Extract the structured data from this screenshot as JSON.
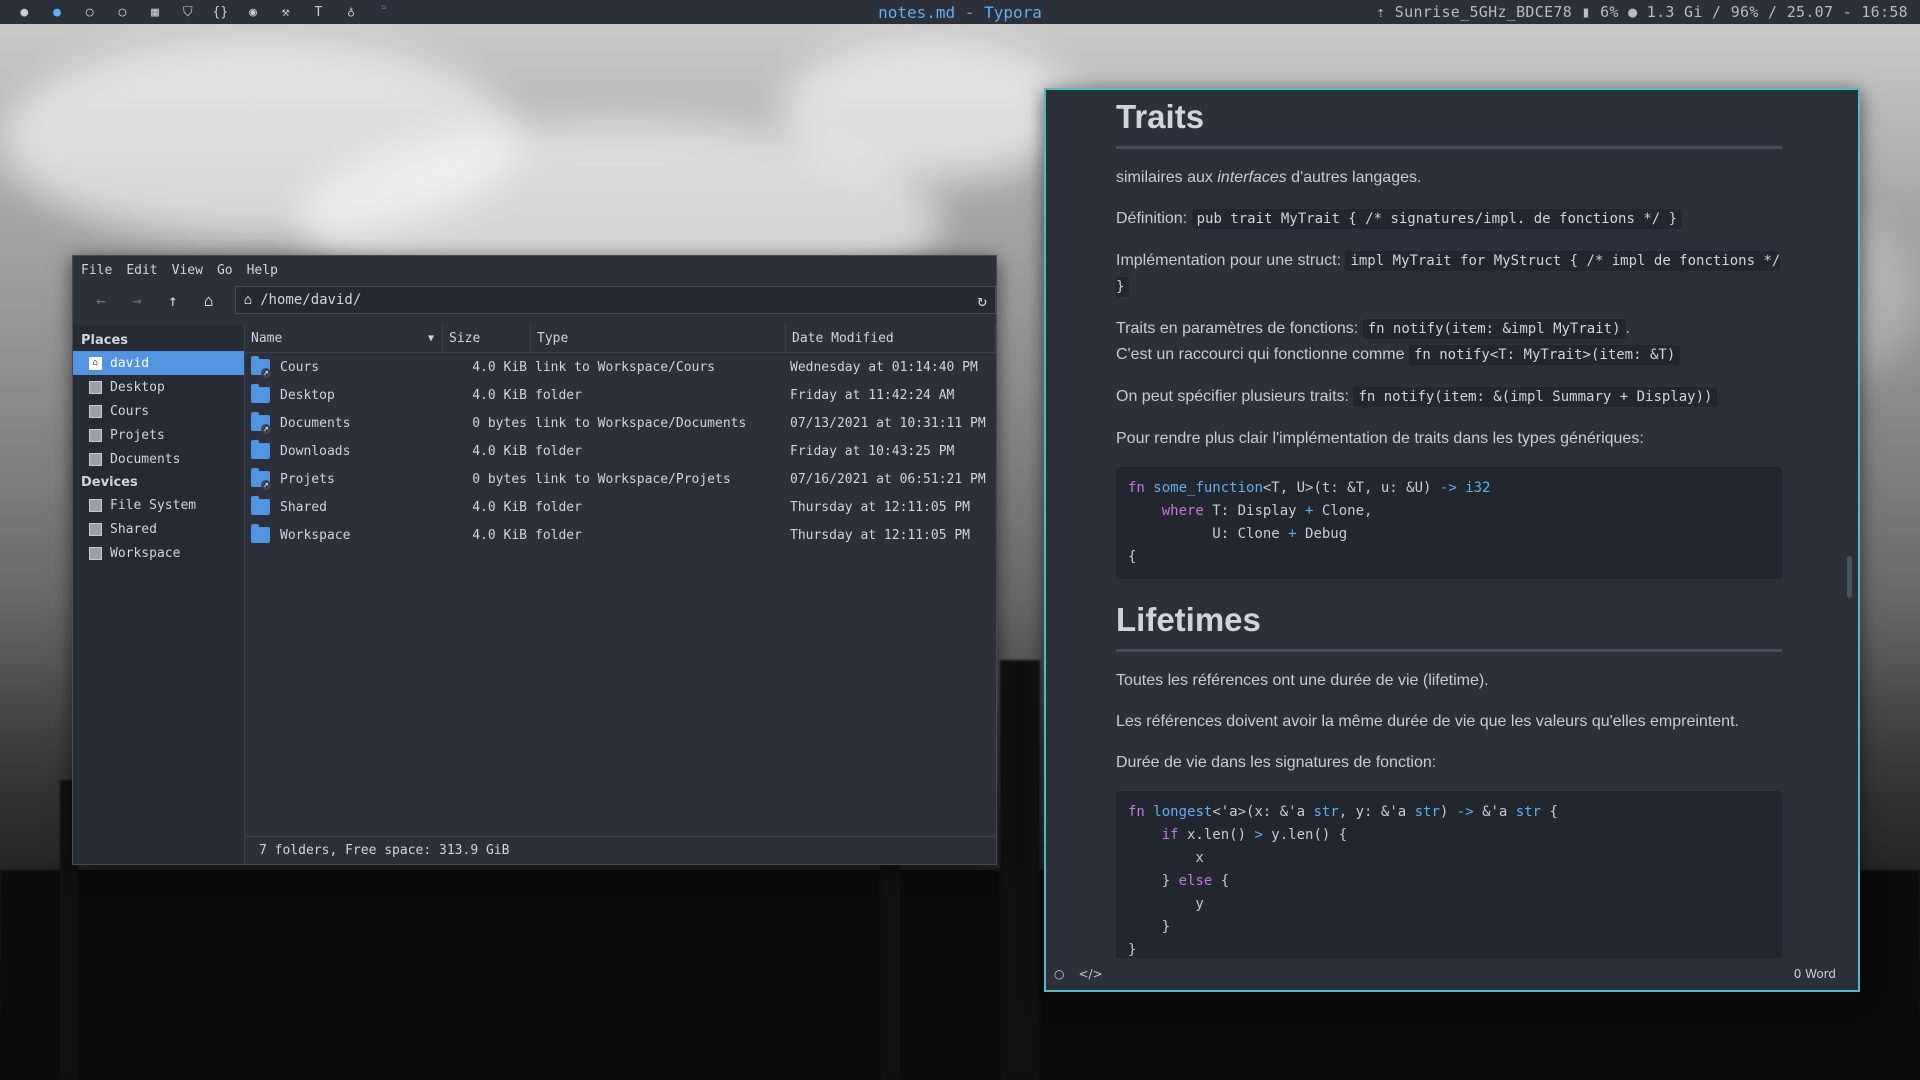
{
  "topbar": {
    "icons": [
      "circle-icon",
      "circle-icon",
      "circle-outline-icon",
      "circle-outline-icon",
      "grid-icon",
      "shield-icon",
      "braces-icon",
      "disc-icon",
      "wrench-icon",
      "text-icon",
      "drop-icon",
      "dot-icon"
    ],
    "title": "notes.md - Typora",
    "status": "⇡ Sunrise_5GHz_BDCE78  ▮ 6%  ● 1.3 Gi / 96% / 25.07 - 16:58"
  },
  "file_manager": {
    "menu": [
      "File",
      "Edit",
      "View",
      "Go",
      "Help"
    ],
    "path": "/home/david/",
    "places_heading": "Places",
    "places": [
      "david",
      "Desktop",
      "Cours",
      "Projets",
      "Documents"
    ],
    "devices_heading": "Devices",
    "devices": [
      "File System",
      "Shared",
      "Workspace"
    ],
    "columns": [
      "Name",
      "Size",
      "Type",
      "Date Modified"
    ],
    "rows": [
      {
        "name": "Cours",
        "size": "4.0 KiB",
        "type": "link to Workspace/Cours",
        "date": "Wednesday at 01:14:40 PM",
        "link": true
      },
      {
        "name": "Desktop",
        "size": "4.0 KiB",
        "type": "folder",
        "date": "Friday at 11:42:24 AM",
        "link": false
      },
      {
        "name": "Documents",
        "size": "0 bytes",
        "type": "link to Workspace/Documents",
        "date": "07/13/2021 at 10:31:11 PM",
        "link": true
      },
      {
        "name": "Downloads",
        "size": "4.0 KiB",
        "type": "folder",
        "date": "Friday at 10:43:25 PM",
        "link": false
      },
      {
        "name": "Projets",
        "size": "0 bytes",
        "type": "link to Workspace/Projets",
        "date": "07/16/2021 at 06:51:21 PM",
        "link": true
      },
      {
        "name": "Shared",
        "size": "4.0 KiB",
        "type": "folder",
        "date": "Thursday at 12:11:05 PM",
        "link": false
      },
      {
        "name": "Workspace",
        "size": "4.0 KiB",
        "type": "folder",
        "date": "Thursday at 12:11:05 PM",
        "link": false
      }
    ],
    "status": "7 folders, Free space: 313.9 GiB"
  },
  "typora": {
    "h1_traits": "Traits",
    "p1_a": "similaires aux ",
    "p1_em": "interfaces",
    "p1_b": " d'autres langages.",
    "p2_label": "Définition: ",
    "p2_code": "pub trait MyTrait { /* signatures/impl. de fonctions */  }",
    "p3_label": "Implémentation pour une struct: ",
    "p3_code": "impl MyTrait for MyStruct { /* impl de fonctions */ }",
    "p4_label": "Traits en paramètres de fonctions: ",
    "p4_code": "fn notify(item: &impl MyTrait)",
    "p4_end": ".",
    "p4b_label": "C'est un raccourci qui fonctionne comme ",
    "p4b_code": "fn notify<T: MyTrait>(item: &T)",
    "p5_label": "On peut spécifier plusieurs traits: ",
    "p5_code": "fn notify(item: &(impl Summary + Display))",
    "p6": "Pour rendre plus clair l'implémentation de traits dans les types génériques:",
    "h1_lifetimes": "Lifetimes",
    "p7": "Toutes les références ont une durée de vie (lifetime).",
    "p8": "Les références doivent avoir la même durée de vie que les valeurs qu'elles empreintent.",
    "p9": "Durée de vie dans les signatures de fonction:",
    "footer_words": "0 Word"
  }
}
